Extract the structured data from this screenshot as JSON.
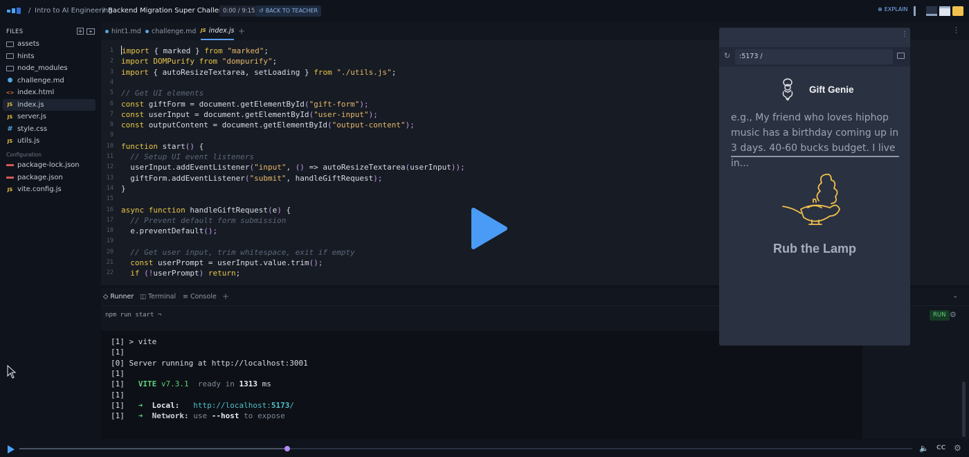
{
  "header": {
    "sep": "/",
    "course": "Intro to AI Engineering",
    "challenge": "Backend Migration Super Challenge",
    "timer": "0:00 / 9:15",
    "back_label": "BACK TO TEACHER",
    "explain_label": "EXPLAIN"
  },
  "sidebar": {
    "title": "FILES",
    "files": [
      {
        "name": "assets",
        "kind": "folder"
      },
      {
        "name": "hints",
        "kind": "folder"
      },
      {
        "name": "node_modules",
        "kind": "folder"
      },
      {
        "name": "challenge.md",
        "kind": "md"
      },
      {
        "name": "index.html",
        "kind": "html"
      },
      {
        "name": "index.js",
        "kind": "js",
        "active": true
      },
      {
        "name": "server.js",
        "kind": "js"
      },
      {
        "name": "style.css",
        "kind": "css"
      },
      {
        "name": "utils.js",
        "kind": "js"
      }
    ],
    "config_label": "Configuration",
    "config_files": [
      {
        "name": "package-lock.json",
        "kind": "json"
      },
      {
        "name": "package.json",
        "kind": "json"
      },
      {
        "name": "vite.config.js",
        "kind": "js"
      }
    ]
  },
  "editor": {
    "tabs": [
      {
        "label": "hint1.md",
        "icon": "md-dot",
        "active": false
      },
      {
        "label": "challenge.md",
        "icon": "md-dot",
        "active": false
      },
      {
        "label": "index.js",
        "icon": "js",
        "active": true
      }
    ],
    "lines": [
      "import { marked } from \"marked\";",
      "import DOMPurify from \"dompurify\";",
      "import { autoResizeTextarea, setLoading } from \"./utils.js\";",
      "",
      "// Get UI elements",
      "const giftForm = document.getElementById(\"gift-form\");",
      "const userInput = document.getElementById(\"user-input\");",
      "const outputContent = document.getElementById(\"output-content\");",
      "",
      "function start() {",
      "  // Setup UI event listeners",
      "  userInput.addEventListener(\"input\", () => autoResizeTextarea(userInput));",
      "  giftForm.addEventListener(\"submit\", handleGiftRequest);",
      "}",
      "",
      "async function handleGiftRequest(e) {",
      "  // Prevent default form submission",
      "  e.preventDefault();",
      "",
      "  // Get user input, trim whitespace, exit if empty",
      "  const userPrompt = userInput.value.trim();",
      "  if (!userPrompt) return;"
    ]
  },
  "runner": {
    "tabs": [
      "Runner",
      "Terminal",
      "Console"
    ],
    "command": "npm run start",
    "command_suffix": "¬",
    "run_label": "RUN",
    "terminal": [
      "[1] > vite",
      "[1]",
      "[0] Server running at http://localhost:3001",
      "[1]",
      "[1]   VITE v7.3.1  ready in 1313 ms",
      "[1]",
      "[1]   ➜  Local:   http://localhost:5173/",
      "[1]   ➜  Network: use --host to expose"
    ]
  },
  "preview": {
    "url": ":5173 /",
    "app_title": "Gift Genie",
    "placeholder": "e.g., My friend who loves hiphop music has a birthday coming up in 3 days. 40-60 bucks budget. I live in...",
    "lamp_label": "Rub the Lamp"
  },
  "playback": {
    "progress": 0.3
  },
  "colors": {
    "accent": "#5b9cf5",
    "keyword": "#e8c547",
    "string": "#e6b96a",
    "comment": "#5c6779",
    "terminal_green": "#5ed07a",
    "terminal_cyan": "#4fc1c9",
    "lamp": "#f2c14b"
  }
}
